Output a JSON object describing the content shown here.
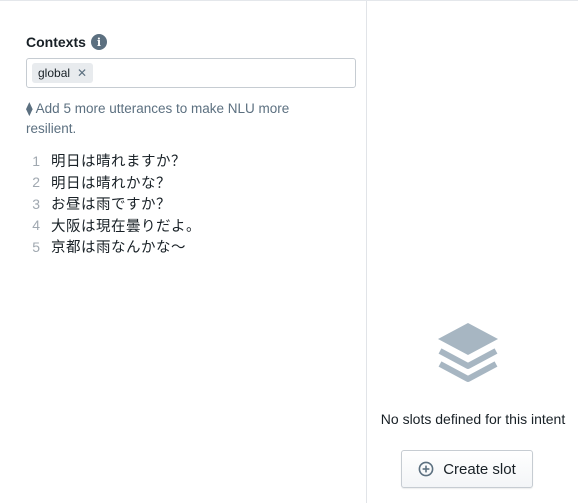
{
  "contexts": {
    "heading": "Contexts",
    "tags": [
      {
        "label": "global"
      }
    ]
  },
  "hint": {
    "text": "Add 5 more utterances to make NLU more resilient."
  },
  "utterances": [
    {
      "number": "1",
      "text": "明日は晴れますか？"
    },
    {
      "number": "2",
      "text": "明日は晴れかな？"
    },
    {
      "number": "3",
      "text": "お昼は雨ですか？"
    },
    {
      "number": "4",
      "text": "大阪は現在曇りだよ。"
    },
    {
      "number": "5",
      "text": "京都は雨なんかな〜"
    }
  ],
  "slots": {
    "empty_message": "No slots defined for this intent",
    "create_label": "Create slot"
  },
  "icons": {
    "info": "info-icon",
    "tag_remove": "close-icon",
    "hint": "diamond-icon",
    "empty": "layers-icon",
    "create": "plus-circle-icon"
  },
  "colors": {
    "muted": "#5c7080",
    "text": "#182026",
    "empty_icon": "#a7b6c2"
  }
}
